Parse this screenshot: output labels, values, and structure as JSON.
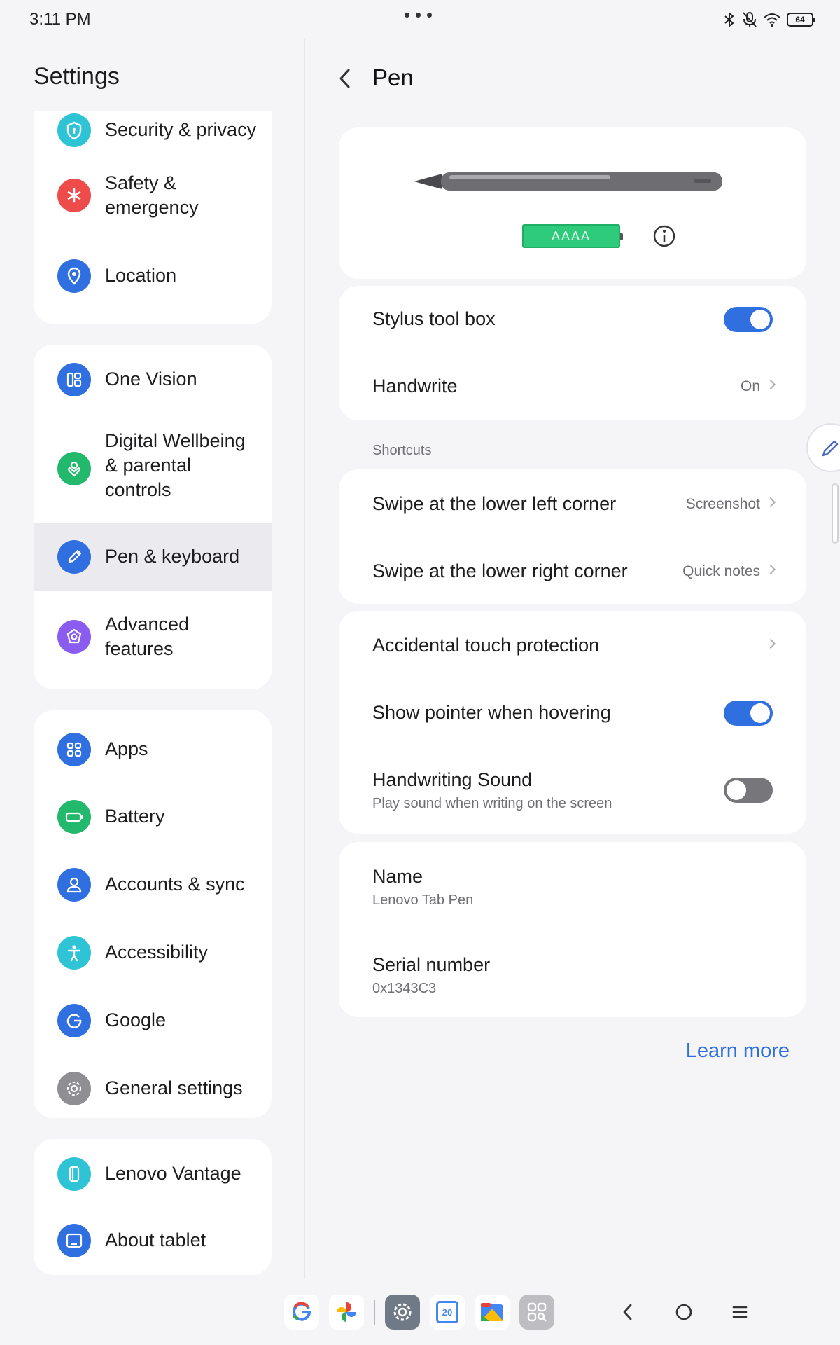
{
  "status_bar": {
    "time": "3:11 PM",
    "icons": [
      "bluetooth-icon",
      "mic-off-icon",
      "wifi-icon",
      "battery-icon"
    ],
    "battery_level": "64"
  },
  "sidebar": {
    "title": "Settings",
    "groups": [
      {
        "items": [
          {
            "label": "Security & privacy",
            "icon": "shield-icon",
            "color": "#2ec4d6"
          },
          {
            "label": "Safety & emergency",
            "icon": "asterisk-icon",
            "color": "#ee4b4b"
          },
          {
            "label": "Location",
            "icon": "location-pin-icon",
            "color": "#2f6fe0"
          }
        ]
      },
      {
        "items": [
          {
            "label": "One Vision",
            "icon": "one-vision-icon",
            "color": "#2f6fe0"
          },
          {
            "label": "Digital Wellbeing & parental controls",
            "icon": "wellbeing-icon",
            "color": "#23b96c"
          },
          {
            "label": "Pen & keyboard",
            "icon": "pen-icon",
            "color": "#2f6fe0",
            "selected": true
          },
          {
            "label": "Advanced features",
            "icon": "advanced-features-icon",
            "color": "#8a5cf0"
          }
        ]
      },
      {
        "items": [
          {
            "label": "Apps",
            "icon": "apps-grid-icon",
            "color": "#2f6fe0"
          },
          {
            "label": "Battery",
            "icon": "battery-icon",
            "color": "#23b96c"
          },
          {
            "label": "Accounts & sync",
            "icon": "person-icon",
            "color": "#2f6fe0"
          },
          {
            "label": "Accessibility",
            "icon": "accessibility-icon",
            "color": "#2ec4d6"
          },
          {
            "label": "Google",
            "icon": "google-g-icon",
            "color": "#2f6fe0"
          },
          {
            "label": "General settings",
            "icon": "gear-icon",
            "color": "#8e8e93"
          }
        ]
      },
      {
        "items": [
          {
            "label": "Lenovo Vantage",
            "icon": "vantage-icon",
            "color": "#2ec4d6"
          },
          {
            "label": "About tablet",
            "icon": "tablet-icon",
            "color": "#2f6fe0"
          }
        ]
      }
    ]
  },
  "detail": {
    "title": "Pen",
    "pen_card": {
      "battery_label": "AAAA"
    },
    "stylus_tool_box": {
      "label": "Stylus tool box",
      "enabled": true
    },
    "handwrite": {
      "label": "Handwrite",
      "value": "On"
    },
    "shortcuts": {
      "section_label": "Shortcuts",
      "lower_left": {
        "label": "Swipe at the lower left corner",
        "value": "Screenshot"
      },
      "lower_right": {
        "label": "Swipe at the lower right corner",
        "value": "Quick notes"
      }
    },
    "accidental_touch": {
      "label": "Accidental touch protection"
    },
    "show_pointer": {
      "label": "Show pointer when hovering",
      "enabled": true
    },
    "handwriting_sound": {
      "label": "Handwriting Sound",
      "description": "Play sound when writing on the screen",
      "enabled": false
    },
    "name": {
      "label": "Name",
      "value": "Lenovo Tab Pen"
    },
    "serial": {
      "label": "Serial number",
      "value": "0x1343C3"
    },
    "learn_more": "Learn more"
  },
  "dock": {
    "apps": [
      "google-icon",
      "photos-icon",
      "settings-icon",
      "calendar-icon",
      "files-icon",
      "app-library-icon"
    ],
    "calendar_day": "20",
    "nav": [
      "back-icon",
      "home-icon",
      "menu-icon"
    ]
  }
}
